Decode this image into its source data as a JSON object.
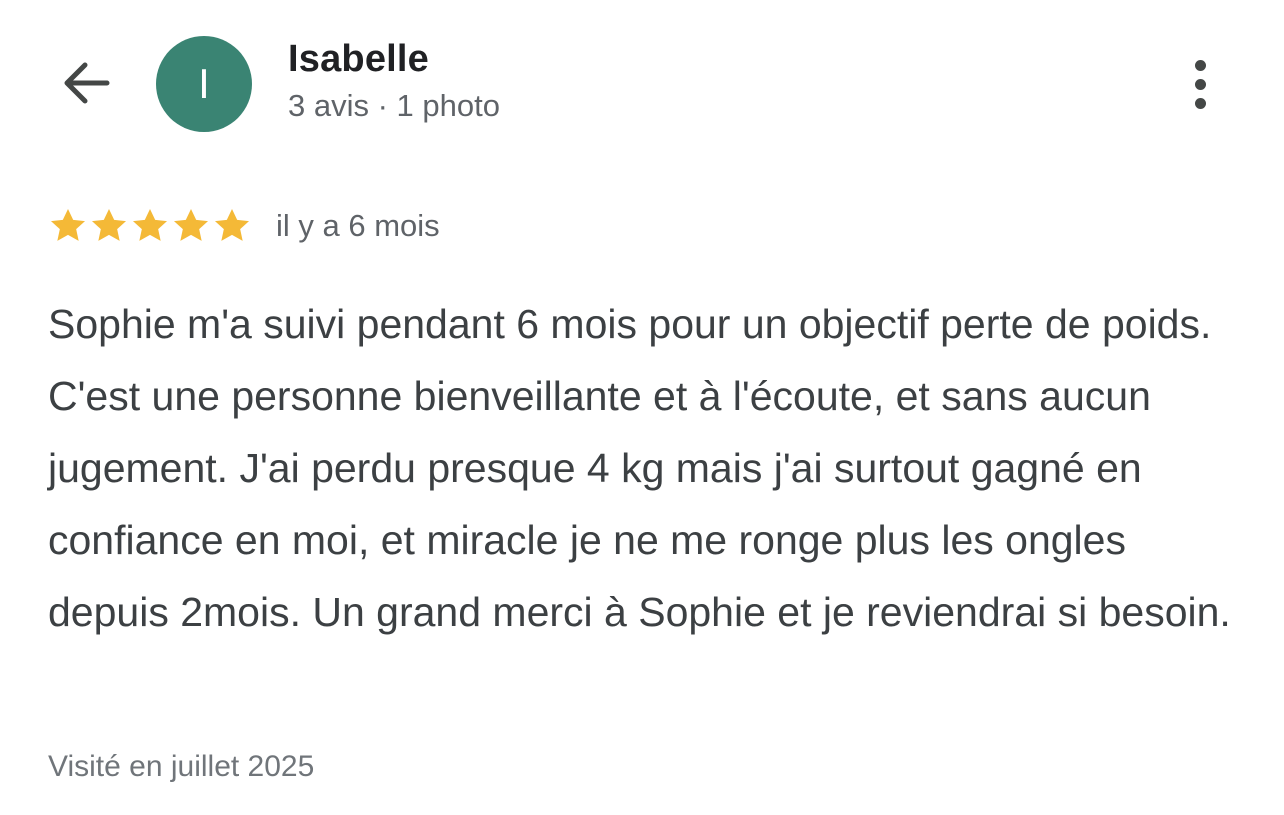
{
  "header": {
    "back_icon": "arrow-left-icon",
    "more_icon": "more-vertical-icon"
  },
  "reviewer": {
    "avatar_initial": "I",
    "avatar_color": "#3a8473",
    "name": "Isabelle",
    "meta": "3 avis · 1 photo"
  },
  "review": {
    "rating": 5,
    "rating_max": 5,
    "star_color": "#f4b937",
    "date": "il y a 6 mois",
    "text": "Sophie m'a suivi pendant 6 mois pour un objectif perte de poids. C'est une personne bienveillante et à l'écoute, et sans aucun jugement. J'ai perdu presque 4 kg mais j'ai surtout gagné en confiance en moi, et miracle je ne me ronge plus les ongles depuis 2mois. Un grand merci à Sophie et je reviendrai si besoin.",
    "visit": "Visité en juillet 2025"
  }
}
